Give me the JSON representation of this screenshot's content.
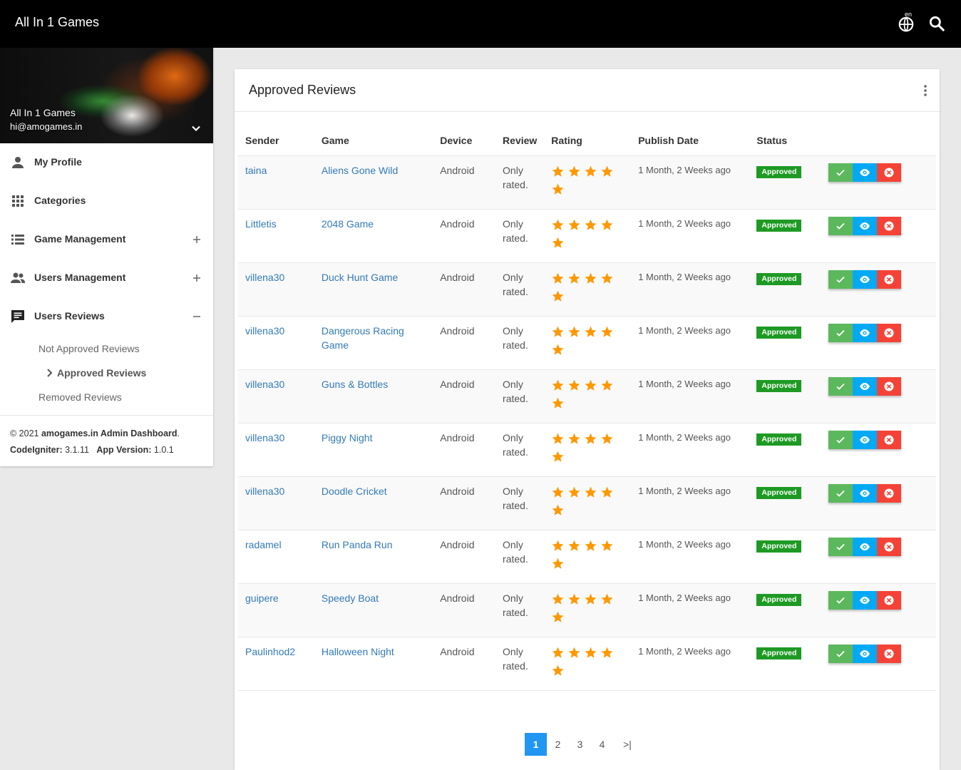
{
  "app": {
    "title": "All In 1 Games",
    "lang_code": "en"
  },
  "user": {
    "name": "All In 1 Games",
    "email": "hi@amogames.in"
  },
  "sidebar": {
    "items": [
      {
        "label": "My Profile",
        "icon": "person-icon"
      },
      {
        "label": "Categories",
        "icon": "apps-icon"
      },
      {
        "label": "Game Management",
        "icon": "list-icon"
      },
      {
        "label": "Users Management",
        "icon": "people-icon"
      },
      {
        "label": "Users Reviews",
        "icon": "comment-icon"
      }
    ],
    "sub_items": [
      "Not Approved Reviews",
      "Approved Reviews",
      "Removed Reviews"
    ]
  },
  "legal": {
    "copyright": "© 2021 ",
    "site": "amogames.in Admin Dashboard",
    "dot": ".",
    "framework_label": "CodeIgniter:",
    "framework_version": "3.1.11",
    "version_label": "App Version:",
    "version": "1.0.1"
  },
  "card": {
    "title": "Approved Reviews"
  },
  "table": {
    "headers": [
      "Sender",
      "Game",
      "Device",
      "Review",
      "Rating",
      "Publish Date",
      "Status"
    ],
    "rows": [
      {
        "sender": "taina",
        "game": "Aliens Gone Wild",
        "device": "Android",
        "review": "Only rated.",
        "rating": 5,
        "date": "1 Month, 2 Weeks ago",
        "status": "Approved"
      },
      {
        "sender": "Littletis",
        "game": "2048 Game",
        "device": "Android",
        "review": "Only rated.",
        "rating": 5,
        "date": "1 Month, 2 Weeks ago",
        "status": "Approved"
      },
      {
        "sender": "villena30",
        "game": "Duck Hunt Game",
        "device": "Android",
        "review": "Only rated.",
        "rating": 5,
        "date": "1 Month, 2 Weeks ago",
        "status": "Approved"
      },
      {
        "sender": "villena30",
        "game": "Dangerous Racing Game",
        "device": "Android",
        "review": "Only rated.",
        "rating": 5,
        "date": "1 Month, 2 Weeks ago",
        "status": "Approved"
      },
      {
        "sender": "villena30",
        "game": "Guns & Bottles",
        "device": "Android",
        "review": "Only rated.",
        "rating": 5,
        "date": "1 Month, 2 Weeks ago",
        "status": "Approved"
      },
      {
        "sender": "villena30",
        "game": "Piggy Night",
        "device": "Android",
        "review": "Only rated.",
        "rating": 5,
        "date": "1 Month, 2 Weeks ago",
        "status": "Approved"
      },
      {
        "sender": "villena30",
        "game": "Doodle Cricket",
        "device": "Android",
        "review": "Only rated.",
        "rating": 5,
        "date": "1 Month, 2 Weeks ago",
        "status": "Approved"
      },
      {
        "sender": "radamel",
        "game": "Run Panda Run",
        "device": "Android",
        "review": "Only rated.",
        "rating": 5,
        "date": "1 Month, 2 Weeks ago",
        "status": "Approved"
      },
      {
        "sender": "guipere",
        "game": "Speedy Boat",
        "device": "Android",
        "review": "Only rated.",
        "rating": 5,
        "date": "1 Month, 2 Weeks ago",
        "status": "Approved"
      },
      {
        "sender": "Paulinhod2",
        "game": "Halloween Night",
        "device": "Android",
        "review": "Only rated.",
        "rating": 5,
        "date": "1 Month, 2 Weeks ago",
        "status": "Approved"
      }
    ]
  },
  "pagination": {
    "pages": [
      "1",
      "2",
      "3",
      "4"
    ],
    "current": "1",
    "last_label": ">|"
  },
  "colors": {
    "accent": "#2196f3",
    "approved": "#1e9a24",
    "star": "#ff9800",
    "link": "#337ab7"
  }
}
